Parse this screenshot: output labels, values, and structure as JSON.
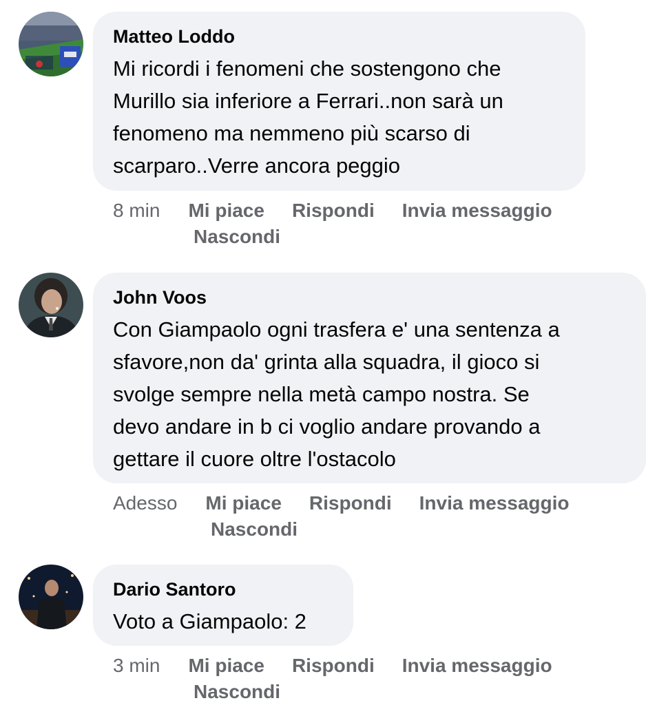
{
  "comments": [
    {
      "author": "Matteo Loddo",
      "avatar": "stadium-photo-avatar",
      "text": "Mi ricordi i fenomeni che sostengono che\nMurillo sia inferiore a Ferrari..non sarà un\nfenomeno ma nemmeno più scarso di\nscarparo..Verre ancora peggio",
      "time": "8 min",
      "like": "Mi piace",
      "reply": "Rispondi",
      "message": "Invia messaggio",
      "hide": "Nascondi"
    },
    {
      "author": "John Voos",
      "avatar": "man-in-suit-avatar",
      "text": "Con Giampaolo ogni trasfera e' una sentenza a\nsfavore,non da' grinta alla squadra, il gioco si\nsvolge sempre nella metà campo  nostra. Se\ndevo andare in b ci voglio andare provando a\ngettare il cuore oltre l'ostacolo",
      "time": "Adesso",
      "like": "Mi piace",
      "reply": "Rispondi",
      "message": "Invia messaggio",
      "hide": "Nascondi"
    },
    {
      "author": "Dario Santoro",
      "avatar": "night-photo-avatar",
      "text": "Voto a Giampaolo: 2",
      "time": "3 min",
      "like": "Mi piace",
      "reply": "Rispondi",
      "message": "Invia messaggio",
      "hide": "Nascondi"
    }
  ],
  "colors": {
    "bubble": "#f0f2f5",
    "text": "#050505",
    "secondary": "#65676b"
  }
}
